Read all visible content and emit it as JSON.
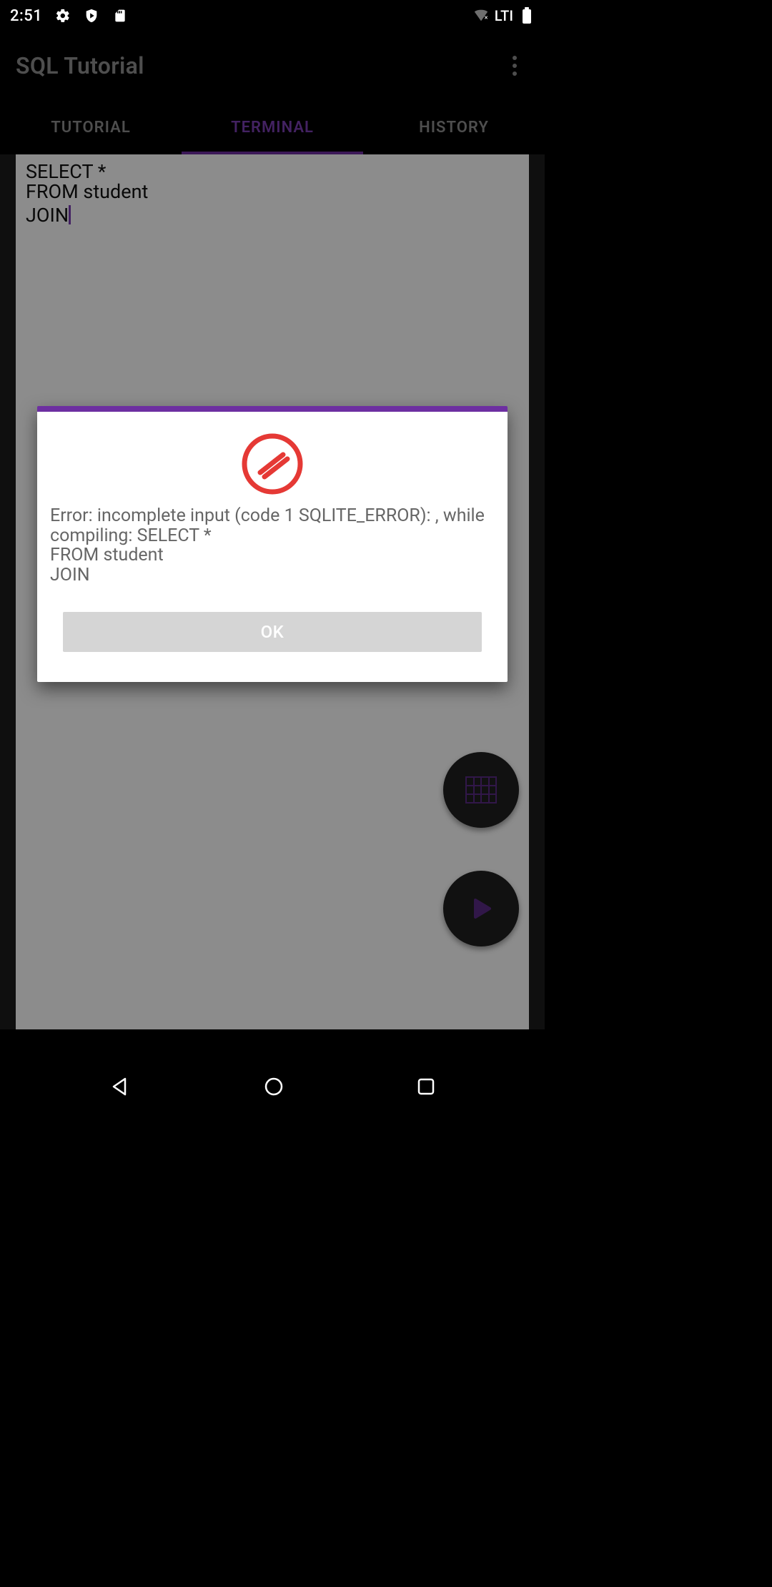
{
  "statusBar": {
    "time": "2:51",
    "network": "LTI"
  },
  "appBar": {
    "title": "SQL Tutorial"
  },
  "tabs": {
    "items": [
      {
        "label": "TUTORIAL",
        "active": false
      },
      {
        "label": "TERMINAL",
        "active": true
      },
      {
        "label": "HISTORY",
        "active": false
      }
    ]
  },
  "editor": {
    "content": "SELECT *\nFROM student\nJOIN"
  },
  "dialog": {
    "message": "Error: incomplete input (code 1 SQLITE_ERROR): , while compiling: SELECT *\nFROM student\nJOIN",
    "ok_label": "OK"
  },
  "colors": {
    "accent": "#6d2fa1",
    "tab_active": "#7b3fb3",
    "error_red": "#e53935"
  }
}
